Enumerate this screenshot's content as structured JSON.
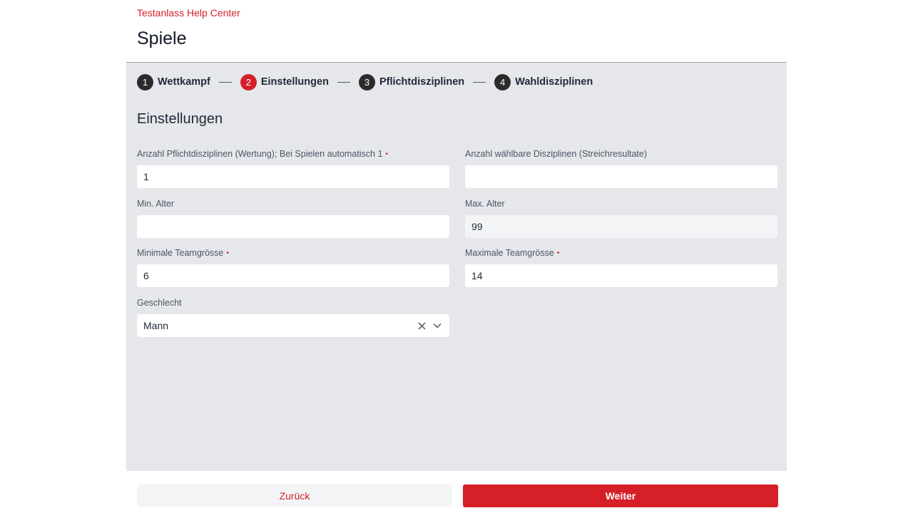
{
  "header": {
    "help_link": "Testanlass Help Center",
    "title": "Spiele"
  },
  "stepper": {
    "steps": [
      {
        "number": "1",
        "label": "Wettkampf",
        "active": false
      },
      {
        "number": "2",
        "label": "Einstellungen",
        "active": true
      },
      {
        "number": "3",
        "label": "Pflichtdisziplinen",
        "active": false
      },
      {
        "number": "4",
        "label": "Wahldisziplinen",
        "active": false
      }
    ]
  },
  "form": {
    "section_title": "Einstellungen",
    "required_marker": "•",
    "fields": {
      "pflicht": {
        "label": "Anzahl Pflichtdisziplinen (Wertung); Bei Spielen automatisch 1",
        "value": "1",
        "required": true
      },
      "wahl": {
        "label": "Anzahl wählbare Disziplinen (Streichresultate)",
        "value": "",
        "required": false
      },
      "min_alter": {
        "label": "Min. Alter",
        "value": "",
        "required": false
      },
      "max_alter": {
        "label": "Max. Alter",
        "value": "99",
        "required": false,
        "readonly": true
      },
      "min_team": {
        "label": "Minimale Teamgrösse",
        "value": "6",
        "required": true
      },
      "max_team": {
        "label": "Maximale Teamgrösse",
        "value": "14",
        "required": true
      },
      "geschlecht": {
        "label": "Geschlecht",
        "value": "Mann",
        "required": false
      }
    }
  },
  "actions": {
    "back_label": "Zurück",
    "next_label": "Weiter"
  },
  "colors": {
    "accent": "#d52029",
    "panel_bg": "#e5e7eb",
    "step_inactive": "#2b2b2b"
  },
  "icons": {
    "clear": "close-icon",
    "dropdown": "chevron-down-icon"
  }
}
